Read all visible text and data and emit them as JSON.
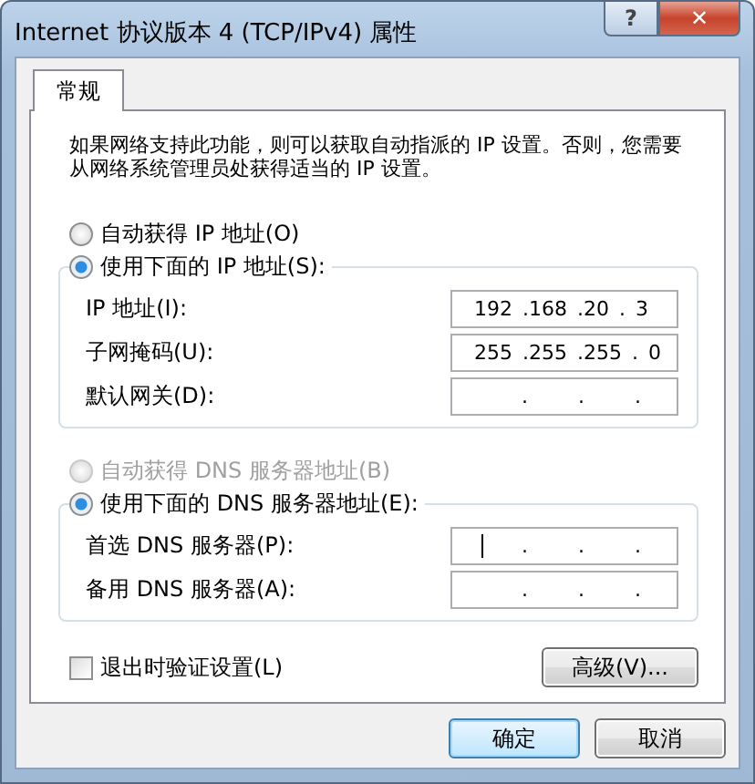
{
  "window": {
    "title": "Internet 协议版本 4 (TCP/IPv4) 属性",
    "help": "?",
    "close": "✕"
  },
  "tabs": [
    {
      "label": "常规",
      "selected": true
    }
  ],
  "description": "如果网络支持此功能，则可以获取自动指派的 IP 设置。否则，您需要从网络系统管理员处获得适当的 IP 设置。",
  "ip_section": {
    "auto_option": {
      "label": "自动获得 IP 地址(O)",
      "selected": false,
      "disabled": false
    },
    "manual_option": {
      "label": "使用下面的 IP 地址(S):",
      "selected": true,
      "disabled": false
    },
    "fields": [
      {
        "label": "IP 地址(I):",
        "value": "192 .168 .20 . 3",
        "focused": false
      },
      {
        "label": "子网掩码(U):",
        "value": "255 .255 .255 . 0",
        "focused": false
      },
      {
        "label": "默认网关(D):",
        "value": ". . .",
        "focused": false
      }
    ]
  },
  "dns_section": {
    "auto_option": {
      "label": "自动获得 DNS 服务器地址(B)",
      "selected": false,
      "disabled": true
    },
    "manual_option": {
      "label": "使用下面的 DNS 服务器地址(E):",
      "selected": true,
      "disabled": false
    },
    "fields": [
      {
        "label": "首选 DNS 服务器(P):",
        "value": ". . .",
        "focused": true
      },
      {
        "label": "备用 DNS 服务器(A):",
        "value": ". . .",
        "focused": false
      }
    ]
  },
  "validate_checkbox": {
    "label": "退出时验证设置(L)",
    "checked": false
  },
  "advanced_button": "高级(V)...",
  "buttons": [
    {
      "label": "确定",
      "default": true
    },
    {
      "label": "取消",
      "default": false
    }
  ]
}
